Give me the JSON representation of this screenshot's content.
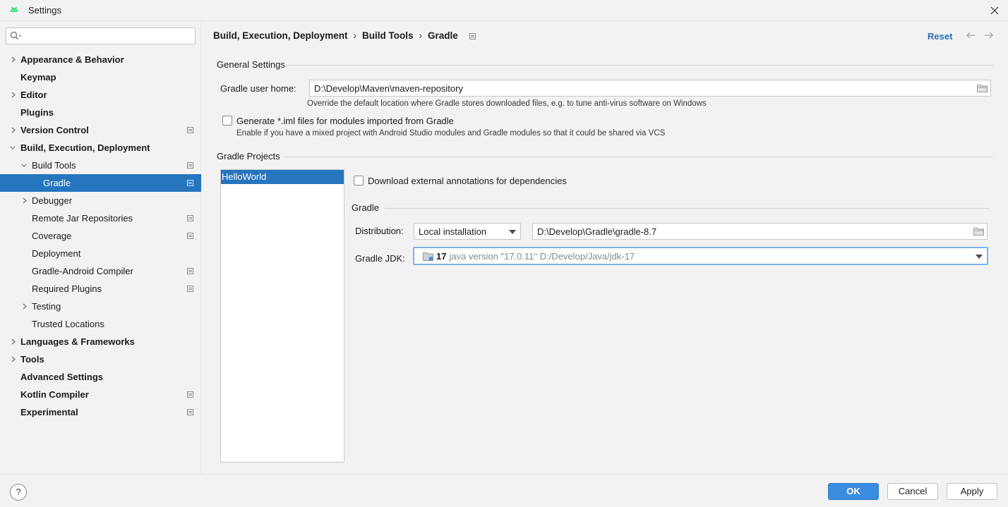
{
  "window": {
    "title": "Settings"
  },
  "search": {
    "placeholder": ""
  },
  "sidebar": {
    "items": [
      {
        "label": "Appearance & Behavior"
      },
      {
        "label": "Keymap"
      },
      {
        "label": "Editor"
      },
      {
        "label": "Plugins"
      },
      {
        "label": "Version Control"
      },
      {
        "label": "Build, Execution, Deployment"
      },
      {
        "label": "Build Tools"
      },
      {
        "label": "Gradle"
      },
      {
        "label": "Debugger"
      },
      {
        "label": "Remote Jar Repositories"
      },
      {
        "label": "Coverage"
      },
      {
        "label": "Deployment"
      },
      {
        "label": "Gradle-Android Compiler"
      },
      {
        "label": "Required Plugins"
      },
      {
        "label": "Testing"
      },
      {
        "label": "Trusted Locations"
      },
      {
        "label": "Languages & Frameworks"
      },
      {
        "label": "Tools"
      },
      {
        "label": "Advanced Settings"
      },
      {
        "label": "Kotlin Compiler"
      },
      {
        "label": "Experimental"
      }
    ],
    "selected": "Gradle"
  },
  "breadcrumb": {
    "items": [
      "Build, Execution, Deployment",
      "Build Tools",
      "Gradle"
    ],
    "separator": "›"
  },
  "header": {
    "reset_label": "Reset"
  },
  "general": {
    "section_title": "General Settings",
    "user_home_label": "Gradle user home:",
    "user_home_value": "D:\\Develop\\Maven\\maven-repository",
    "user_home_hint": "Override the default location where Gradle stores downloaded files, e.g. to tune anti-virus software on Windows",
    "iml_label": "Generate *.iml files for modules imported from Gradle",
    "iml_hint": "Enable if you have a mixed project with Android Studio modules and Gradle modules so that it could be shared via VCS",
    "iml_checked": false
  },
  "projects": {
    "section_title": "Gradle Projects",
    "list": [
      "HelloWorld"
    ],
    "annotations_label": "Download external annotations for dependencies",
    "annotations_checked": false
  },
  "gradle": {
    "section_title": "Gradle",
    "distribution_label": "Distribution:",
    "distribution_value": "Local installation",
    "distribution_path": "D:\\Develop\\Gradle\\gradle-8.7",
    "jdk_label": "Gradle JDK:",
    "jdk_version": "17",
    "jdk_description": "java version \"17.0.11\" D:/Develop/Java/jdk-17"
  },
  "footer": {
    "help_label": "?",
    "ok_label": "OK",
    "cancel_label": "Cancel",
    "apply_label": "Apply"
  },
  "colors": {
    "selection": "#2675bf",
    "link": "#2f6eb5",
    "primary_button": "#3a8ce0"
  }
}
